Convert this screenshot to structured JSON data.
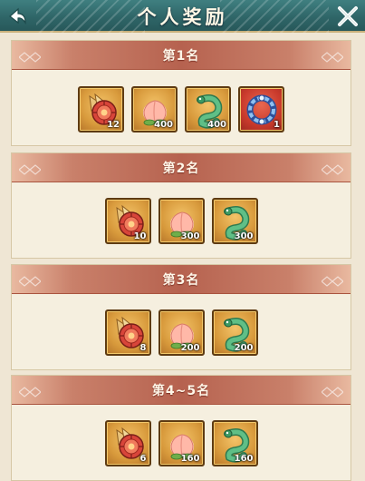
{
  "header": {
    "title": "个人奖励",
    "back_icon": "back-arrow-icon",
    "close_icon": "close-x-icon"
  },
  "ranks": [
    {
      "label": "第1名",
      "items": [
        {
          "icon": "medal-flower-icon",
          "qty": "12",
          "frame": "gold"
        },
        {
          "icon": "peach-icon",
          "qty": "400",
          "frame": "gold"
        },
        {
          "icon": "jade-dragon-icon",
          "qty": "400",
          "frame": "gold"
        },
        {
          "icon": "blue-ring-icon",
          "qty": "1",
          "frame": "red"
        }
      ]
    },
    {
      "label": "第2名",
      "items": [
        {
          "icon": "medal-flower-icon",
          "qty": "10",
          "frame": "gold"
        },
        {
          "icon": "peach-icon",
          "qty": "300",
          "frame": "gold"
        },
        {
          "icon": "jade-dragon-icon",
          "qty": "300",
          "frame": "gold"
        }
      ]
    },
    {
      "label": "第3名",
      "items": [
        {
          "icon": "medal-flower-icon",
          "qty": "8",
          "frame": "gold"
        },
        {
          "icon": "peach-icon",
          "qty": "200",
          "frame": "gold"
        },
        {
          "icon": "jade-dragon-icon",
          "qty": "200",
          "frame": "gold"
        }
      ]
    },
    {
      "label": "第4~5名",
      "items": [
        {
          "icon": "medal-flower-icon",
          "qty": "6",
          "frame": "gold"
        },
        {
          "icon": "peach-icon",
          "qty": "160",
          "frame": "gold"
        },
        {
          "icon": "jade-dragon-icon",
          "qty": "160",
          "frame": "gold"
        }
      ]
    }
  ],
  "colors": {
    "header": "#2f6668",
    "banner": "#b6624f",
    "panel": "#f5efdf"
  }
}
